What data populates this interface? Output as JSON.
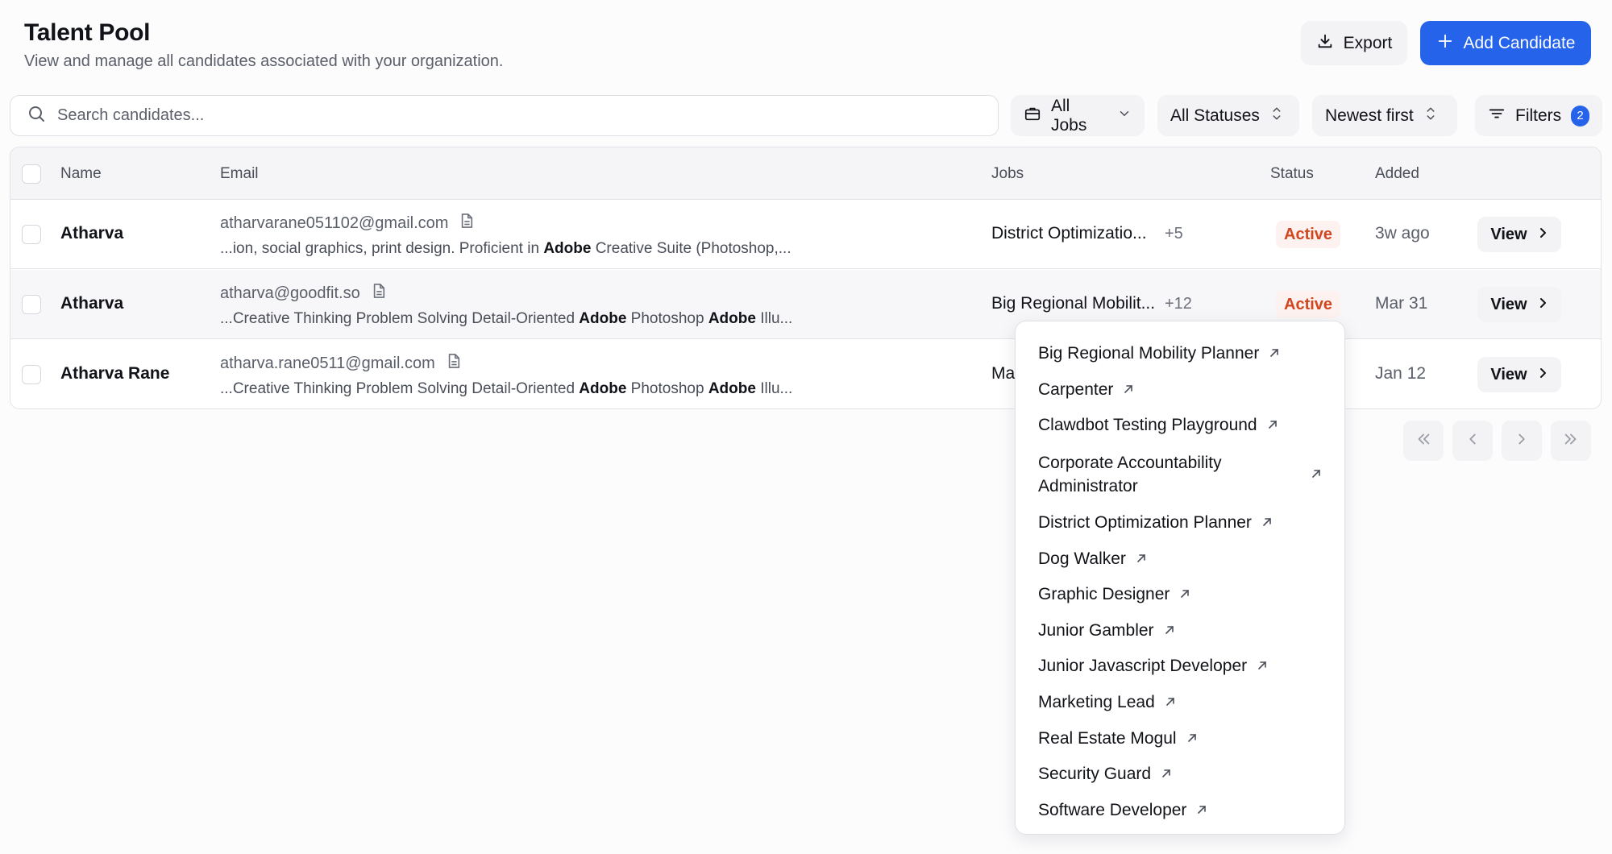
{
  "header": {
    "title": "Talent Pool",
    "subtitle": "View and manage all candidates associated with your organization.",
    "export_label": "Export",
    "add_label": "Add Candidate"
  },
  "toolbar": {
    "search_placeholder": "Search candidates...",
    "jobs_filter": "All Jobs",
    "status_filter": "All Statuses",
    "sort": "Newest first",
    "filters_label": "Filters",
    "filters_count": "2"
  },
  "table": {
    "columns": {
      "name": "Name",
      "email": "Email",
      "jobs": "Jobs",
      "status": "Status",
      "added": "Added"
    },
    "rows": [
      {
        "name": "Atharva",
        "email": "atharvarane051102@gmail.com",
        "snippet_pre": "...ion, social graphics, print design. Proficient in ",
        "snippet_b1": "Adobe",
        "snippet_mid": " Creative Suite (Photoshop,...",
        "snippet_b2": "",
        "snippet_post": "",
        "job": "District Optimizatio...",
        "more": "+5",
        "status": "Active",
        "added": "3w ago",
        "view": "View"
      },
      {
        "name": "Atharva",
        "email": "atharva@goodfit.so",
        "snippet_pre": "...Creative Thinking Problem Solving Detail-Oriented ",
        "snippet_b1": "Adobe",
        "snippet_mid": " Photoshop ",
        "snippet_b2": "Adobe",
        "snippet_post": " Illu...",
        "job": "Big Regional Mobilit...",
        "more": "+12",
        "status": "Active",
        "added": "Mar 31",
        "view": "View"
      },
      {
        "name": "Atharva Rane",
        "email": "atharva.rane0511@gmail.com",
        "snippet_pre": "...Creative Thinking Problem Solving Detail-Oriented ",
        "snippet_b1": "Adobe",
        "snippet_mid": " Photoshop ",
        "snippet_b2": "Adobe",
        "snippet_post": " Illu...",
        "job": "Ma",
        "more": "",
        "status": "",
        "added": "Jan 12",
        "view": "View"
      }
    ]
  },
  "pagination": {
    "info_visible": "3"
  },
  "jobs_popover": {
    "items": [
      "Big Regional Mobility Planner",
      "Carpenter",
      "Clawdbot Testing Playground",
      "Corporate Accountability Administrator",
      "District Optimization Planner",
      "Dog Walker",
      "Graphic Designer",
      "Junior Gambler",
      "Junior Javascript Developer",
      "Marketing Lead",
      "Real Estate Mogul",
      "Security Guard",
      "Software Developer"
    ]
  },
  "colors": {
    "accent": "#2563eb",
    "status_active": "#d2461f",
    "status_active_bg": "#fdf2ef"
  },
  "icons": {
    "export": "download-icon",
    "add": "plus-icon",
    "search": "search-icon",
    "jobs": "briefcase-icon",
    "status": "chevron-up-down-icon",
    "filters": "filter-lines-icon",
    "email_doc": "document-icon",
    "view": "chevron-right-icon",
    "external": "arrow-up-right-icon"
  }
}
